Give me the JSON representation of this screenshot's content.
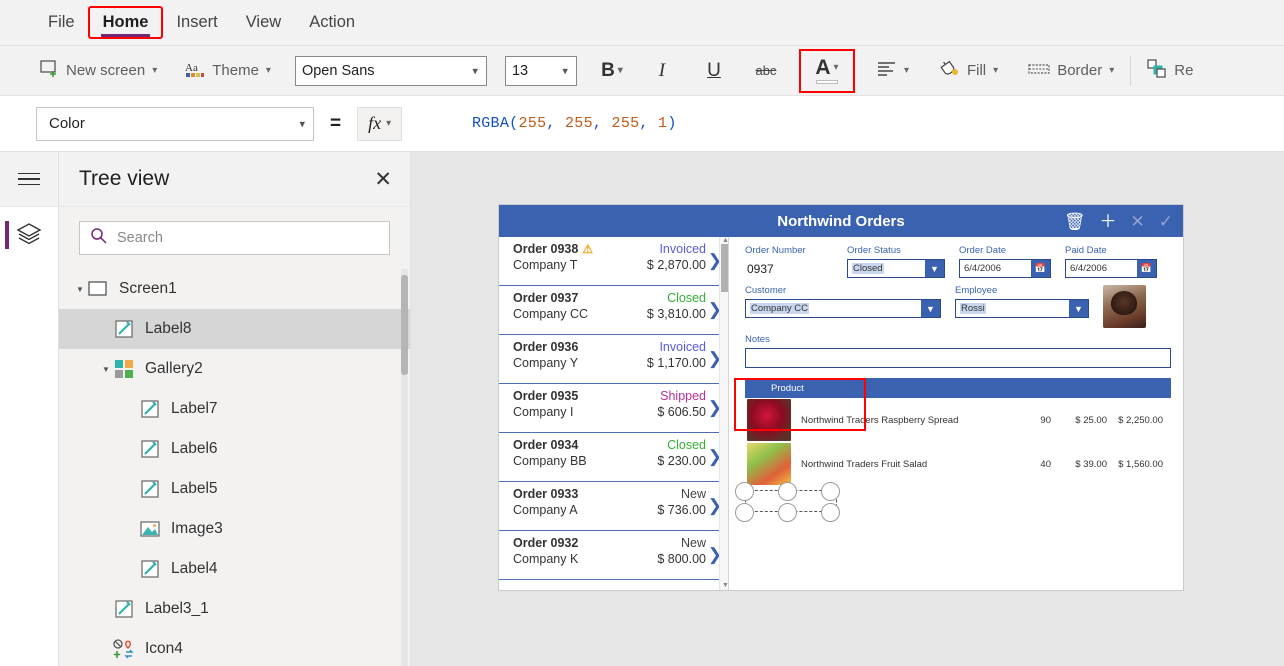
{
  "menubar": {
    "items": [
      {
        "label": "File",
        "active": false
      },
      {
        "label": "Home",
        "active": true
      },
      {
        "label": "Insert",
        "active": false
      },
      {
        "label": "View",
        "active": false
      },
      {
        "label": "Action",
        "active": false
      }
    ]
  },
  "toolbar": {
    "new_screen_label": "New screen",
    "theme_label": "Theme",
    "font_family_value": "Open Sans",
    "font_size_value": "13",
    "bold_label": "B",
    "italic_label": "I",
    "underline_label": "U",
    "strikethrough_label": "abc",
    "font_color_label": "A",
    "font_color_swatch": "#ffffff",
    "align_label": "",
    "fill_label": "Fill",
    "border_label": "Border",
    "reorder_label": "Re"
  },
  "formulabar": {
    "property_value": "Color",
    "equals": "=",
    "fx_label": "fx",
    "formula_parts": [
      {
        "text": "RGBA",
        "kind": "fn"
      },
      {
        "text": "(",
        "kind": "punct"
      },
      {
        "text": "255",
        "kind": "num"
      },
      {
        "text": ", ",
        "kind": "punct"
      },
      {
        "text": "255",
        "kind": "num"
      },
      {
        "text": ", ",
        "kind": "punct"
      },
      {
        "text": "255",
        "kind": "num"
      },
      {
        "text": ", ",
        "kind": "punct"
      },
      {
        "text": "1",
        "kind": "num"
      },
      {
        "text": ")",
        "kind": "punct"
      }
    ]
  },
  "treeview": {
    "title": "Tree view",
    "close_label": "✕",
    "search_placeholder": "Search",
    "search_value": "",
    "items": [
      {
        "label": "Screen1",
        "indent": 0,
        "icon": "screen-icon",
        "expandable": true,
        "selected": false
      },
      {
        "label": "Label8",
        "indent": 1,
        "icon": "label-icon",
        "expandable": false,
        "selected": true
      },
      {
        "label": "Gallery2",
        "indent": 1,
        "icon": "gallery-icon",
        "expandable": true,
        "selected": false
      },
      {
        "label": "Label7",
        "indent": 2,
        "icon": "label-icon",
        "expandable": false,
        "selected": false
      },
      {
        "label": "Label6",
        "indent": 2,
        "icon": "label-icon",
        "expandable": false,
        "selected": false
      },
      {
        "label": "Label5",
        "indent": 2,
        "icon": "label-icon",
        "expandable": false,
        "selected": false
      },
      {
        "label": "Image3",
        "indent": 2,
        "icon": "image-icon",
        "expandable": false,
        "selected": false
      },
      {
        "label": "Label4",
        "indent": 2,
        "icon": "label-icon",
        "expandable": false,
        "selected": false
      },
      {
        "label": "Label3_1",
        "indent": 1,
        "icon": "label-icon",
        "expandable": false,
        "selected": false
      },
      {
        "label": "Icon4",
        "indent": 1,
        "icon": "icons-icon",
        "expandable": false,
        "selected": false
      }
    ]
  },
  "app": {
    "header": {
      "title": "Northwind Orders",
      "icons": [
        {
          "name": "delete-icon",
          "glyph": "🗑",
          "dim": false
        },
        {
          "name": "add-icon",
          "glyph": "＋",
          "dim": false
        },
        {
          "name": "cancel-icon",
          "glyph": "✕",
          "dim": true
        },
        {
          "name": "confirm-icon",
          "glyph": "✓",
          "dim": true
        }
      ]
    },
    "gallery": {
      "orders": [
        {
          "number": "Order 0938",
          "company": "Company T",
          "status": "Invoiced",
          "status_color": "#5b5bd6",
          "amount": "$ 2,870.00",
          "warning": true
        },
        {
          "number": "Order 0937",
          "company": "Company CC",
          "status": "Closed",
          "status_color": "#35b035",
          "amount": "$ 3,810.00",
          "warning": false
        },
        {
          "number": "Order 0936",
          "company": "Company Y",
          "status": "Invoiced",
          "status_color": "#5b5bd6",
          "amount": "$ 1,170.00",
          "warning": false
        },
        {
          "number": "Order 0935",
          "company": "Company I",
          "status": "Shipped",
          "status_color": "#b5309b",
          "amount": "$ 606.50",
          "warning": false
        },
        {
          "number": "Order 0934",
          "company": "Company BB",
          "status": "Closed",
          "status_color": "#35b035",
          "amount": "$ 230.00",
          "warning": false
        },
        {
          "number": "Order 0933",
          "company": "Company A",
          "status": "New",
          "status_color": "#444444",
          "amount": "$ 736.00",
          "warning": false
        },
        {
          "number": "Order 0932",
          "company": "Company K",
          "status": "New",
          "status_color": "#444444",
          "amount": "$ 800.00",
          "warning": false
        }
      ]
    },
    "form": {
      "order_number_label": "Order Number",
      "order_number_value": "0937",
      "order_status_label": "Order Status",
      "order_status_value": "Closed",
      "order_date_label": "Order Date",
      "order_date_value": "6/4/2006",
      "paid_date_label": "Paid Date",
      "paid_date_value": "6/4/2006",
      "customer_label": "Customer",
      "customer_value": "Company CC",
      "employee_label": "Employee",
      "employee_value": "Rossi",
      "notes_label": "Notes",
      "notes_value": ""
    },
    "products": {
      "header_label": "Product",
      "rows": [
        {
          "name": "Northwind Traders Raspberry Spread",
          "qty": "90",
          "price": "$ 25.00",
          "total": "$ 2,250.00"
        },
        {
          "name": "Northwind Traders Fruit Salad",
          "qty": "40",
          "price": "$ 39.00",
          "total": "$ 1,560.00"
        }
      ]
    }
  }
}
